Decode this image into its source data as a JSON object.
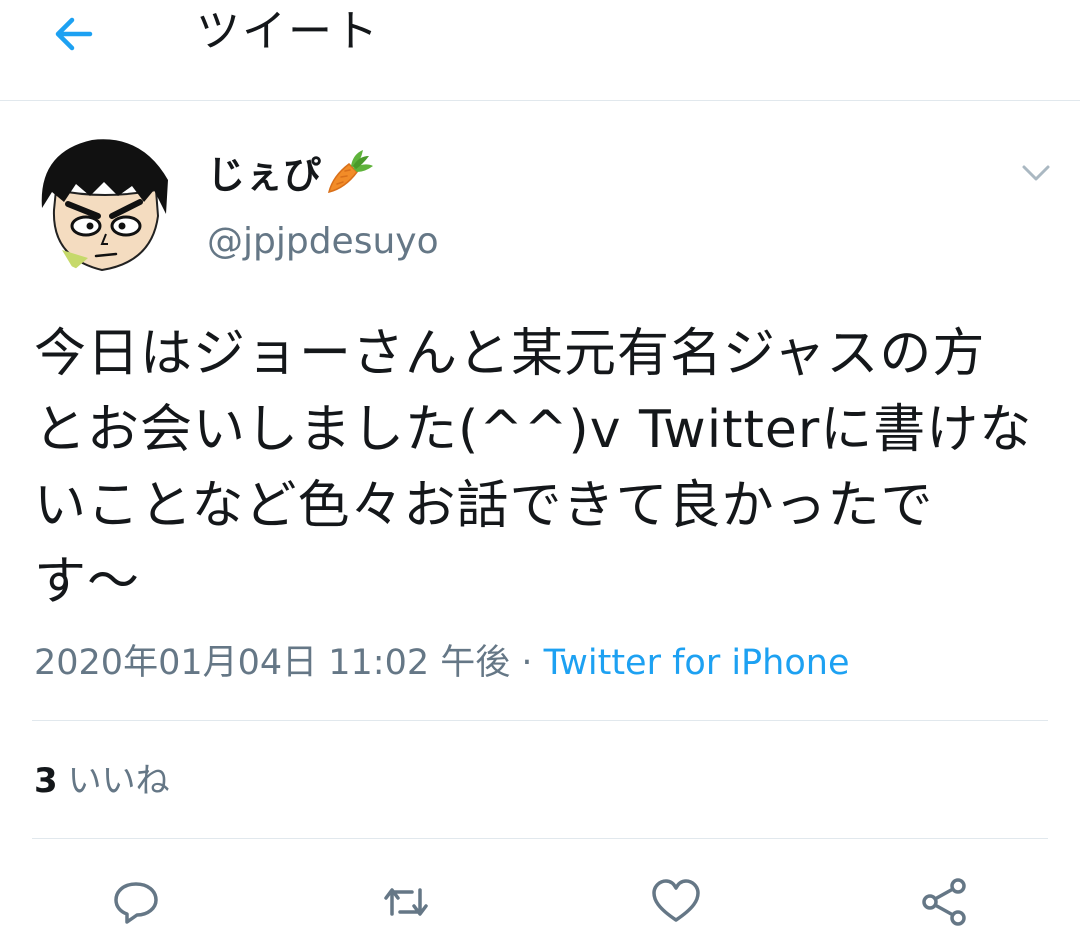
{
  "header": {
    "title": "ツイート",
    "back_icon": "arrow-left-icon",
    "accent_color": "#1da1f2"
  },
  "tweet": {
    "author": {
      "display_name": "じぇぴ",
      "name_emoji": "carrot-icon",
      "handle": "@jpjpdesuyo",
      "avatar": "cartoon-face-avatar"
    },
    "text": "今日はジョーさんと某元有名ジャスの方とお会いしました(^^)v  Twitterに書けないことなど色々お話できて良かったです〜",
    "timestamp": "2020年01月04日 11:02 午後",
    "separator": " · ",
    "source": "Twitter for iPhone",
    "likes": {
      "count": "3",
      "label": "いいね"
    }
  },
  "actions": {
    "reply_icon": "reply-icon",
    "retweet_icon": "retweet-icon",
    "like_icon": "heart-icon",
    "share_icon": "share-icon"
  },
  "colors": {
    "text_primary": "#14171a",
    "text_secondary": "#657786",
    "link": "#1da1f2",
    "divider": "#e1e8ed"
  }
}
